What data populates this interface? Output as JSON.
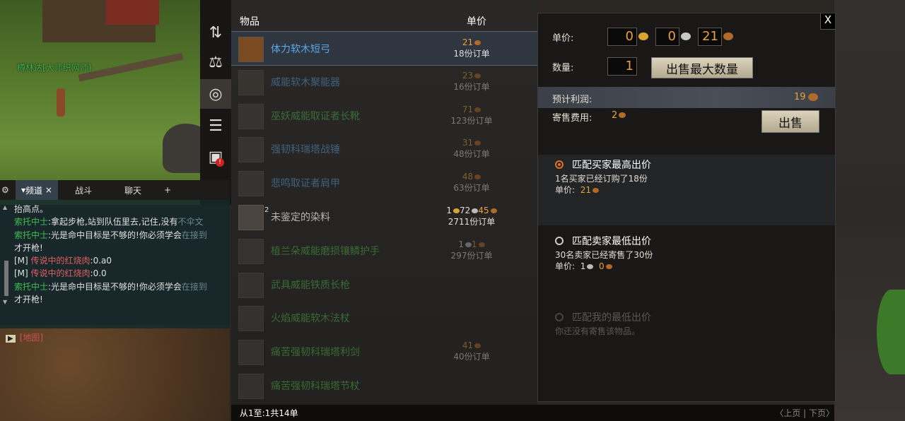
{
  "world": {
    "npc_label": "樽林达[大师织网师]"
  },
  "sidebar": {
    "icons": [
      "swap-icon",
      "scales-icon",
      "coins-icon",
      "list-icon",
      "box-alert-icon"
    ],
    "alert_mark": "!"
  },
  "chat": {
    "tabs": [
      "频道",
      "战斗",
      "聊天"
    ],
    "close_mark": "×",
    "add_mark": "+",
    "lines": [
      {
        "parts": [
          {
            "t": "抬高点。",
            "c": "wh"
          }
        ]
      },
      {
        "parts": [
          {
            "t": "索托中士",
            "c": "spk"
          },
          {
            "t": ":拿起步枪,站到队伍里去,记住,没有",
            "c": "wh"
          },
          {
            "t": "不伞文",
            "c": "dim"
          }
        ]
      },
      {
        "parts": [
          {
            "t": "索托中士",
            "c": "spk"
          },
          {
            "t": ":光是命中目标是不够的!你必须学会",
            "c": "wh"
          },
          {
            "t": "在接到",
            "c": "dim"
          }
        ]
      },
      {
        "parts": [
          {
            "t": "才开枪!",
            "c": "wh"
          }
        ]
      },
      {
        "parts": [
          {
            "t": "[M] ",
            "c": "wh"
          },
          {
            "t": "传说中的红烧肉",
            "c": "leg"
          },
          {
            "t": ":0.a0",
            "c": "wh"
          }
        ]
      },
      {
        "parts": [
          {
            "t": "[M] ",
            "c": "wh"
          },
          {
            "t": "传说中的红烧肉",
            "c": "leg"
          },
          {
            "t": ":0.0",
            "c": "wh"
          }
        ]
      },
      {
        "parts": [
          {
            "t": "索托中士",
            "c": "spk"
          },
          {
            "t": ":光是命中目标是不够的!你必须学会",
            "c": "wh"
          },
          {
            "t": "在接到",
            "c": "dim"
          }
        ]
      },
      {
        "parts": [
          {
            "t": "才开枪!",
            "c": "wh"
          }
        ]
      }
    ],
    "map_link": "[地图]"
  },
  "list": {
    "header_item": "物品",
    "header_price": "单价",
    "rows": [
      {
        "name": "体力软木短弓",
        "price": "21",
        "coins": "c",
        "orders": "18份订单",
        "color": "#5aa8e8",
        "selected": true,
        "faded": false
      },
      {
        "name": "威能软木聚能器",
        "price": "23",
        "coins": "c",
        "orders": "16份订单",
        "color": "#5aa8e8",
        "selected": false,
        "faded": true
      },
      {
        "name": "巫妖威能取证者长靴",
        "price": "71",
        "coins": "c",
        "orders": "123份订单",
        "color": "#4ec04e",
        "selected": false,
        "faded": true
      },
      {
        "name": "强韧科瑞塔战锤",
        "price": "31",
        "coins": "c",
        "orders": "48份订单",
        "color": "#5aa8e8",
        "selected": false,
        "faded": true
      },
      {
        "name": "悲鸣取证者肩甲",
        "price": "48",
        "coins": "c",
        "orders": "63份订单",
        "color": "#5aa8e8",
        "selected": false,
        "faded": true
      },
      {
        "name": "未鉴定的染料",
        "price": "1 72 45",
        "coins": "gsc",
        "orders": "2711份订单",
        "color": "#b8b4ac",
        "selected": false,
        "faded": false,
        "badge": "2"
      },
      {
        "name": "植兰朵威能磨损镶鳞护手",
        "price": "1 1",
        "coins": "sc",
        "orders": "297份订单",
        "color": "#4ec04e",
        "selected": false,
        "faded": true
      },
      {
        "name": "武具威能铁质长枪",
        "price": "",
        "coins": "",
        "orders": "",
        "color": "#4ec04e",
        "selected": false,
        "faded": true
      },
      {
        "name": "火焰威能软木法杖",
        "price": "",
        "coins": "",
        "orders": "",
        "color": "#4ec04e",
        "selected": false,
        "faded": true
      },
      {
        "name": "痛苦强韧科瑞塔利剑",
        "price": "41",
        "coins": "c",
        "orders": "40份订单",
        "color": "#4ec04e",
        "selected": false,
        "faded": true
      },
      {
        "name": "痛苦强韧科瑞塔节杖",
        "price": "",
        "coins": "",
        "orders": "",
        "color": "#4ec04e",
        "selected": false,
        "faded": true
      }
    ]
  },
  "footer": {
    "range": "从1至:1共14单",
    "pager": "〈上页 | 下页〉"
  },
  "sell": {
    "close": "X",
    "unit_price_label": "单价:",
    "gold": "0",
    "silver": "0",
    "copper": "21",
    "qty_label": "数量:",
    "qty": "1",
    "max_button": "出售最大数量",
    "profit_label": "预计利润:",
    "profit_value": "19",
    "fee_label": "寄售费用:",
    "fee_value": "2",
    "sell_button": "出售",
    "opt1_title": "匹配买家最高出价",
    "opt1_line1": "1名买家已经订购了18份",
    "opt1_price_label": "单价:",
    "opt1_price": "21",
    "opt2_title": "匹配卖家最低出价",
    "opt2_line1": "30名卖家已经寄售了30份",
    "opt2_price_label": "单价:",
    "opt2_silver": "1",
    "opt2_copper": "0",
    "opt3_title": "匹配我的最低出价",
    "opt3_line1": "你还没有寄售该物品。",
    "coin_colors": {
      "gold": "#d9a530",
      "silver": "#c8c8c8",
      "copper": "#b06a2a"
    }
  }
}
